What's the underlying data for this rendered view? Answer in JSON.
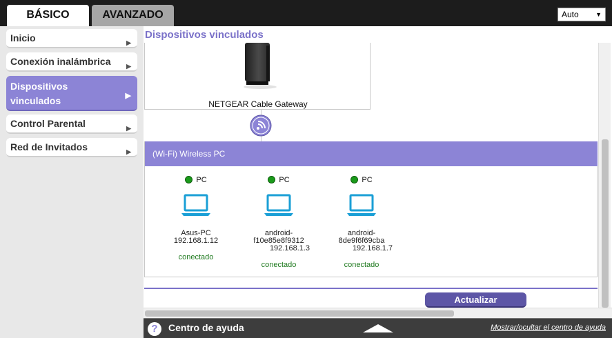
{
  "tabs": [
    {
      "label": "BÁSICO",
      "active": true
    },
    {
      "label": "AVANZADO",
      "active": false
    }
  ],
  "language_select": {
    "value": "Auto"
  },
  "sidebar": {
    "items": [
      {
        "label": "Inicio"
      },
      {
        "label": "Conexión inalámbrica"
      },
      {
        "label": "Dispositivos vinculados",
        "line1": "Dispositivos",
        "line2": "vinculados",
        "active": true
      },
      {
        "label": "Control Parental"
      },
      {
        "label": "Red de Invitados"
      }
    ]
  },
  "main": {
    "title": "Dispositivos vinculados",
    "gateway": {
      "label": "NETGEAR Cable Gateway"
    },
    "wifi_panel": {
      "title": "(Wi-Fi) Wireless PC"
    },
    "devices": [
      {
        "type": "PC",
        "name_lines": [
          "Asus-PC",
          "192.168.1.12"
        ],
        "status": "conectado"
      },
      {
        "type": "PC",
        "name_lines": [
          "android-",
          "f10e85e8f9312",
          "192.168.1.3"
        ],
        "status": "conectado"
      },
      {
        "type": "PC",
        "name_lines": [
          "android-",
          "8de9f6f69cba",
          "192.168.1.7"
        ],
        "status": "conectado"
      }
    ],
    "refresh_label": "Actualizar"
  },
  "help_bar": {
    "icon_label": "?",
    "title": "Centro de ayuda",
    "toggle_label": "Mostrar/ocultar el centro de ayuda"
  },
  "colors": {
    "accent": "#8c84d6",
    "title": "#7b72c9",
    "button": "#5d56a6",
    "status_connected": "#1f7a1f",
    "device_icon": "#1a9fd6"
  },
  "icons": {
    "gateway": "router-icon",
    "wifi": "wifi-icon",
    "device": "laptop-icon",
    "status": "status-dot-icon",
    "help": "help-icon"
  }
}
